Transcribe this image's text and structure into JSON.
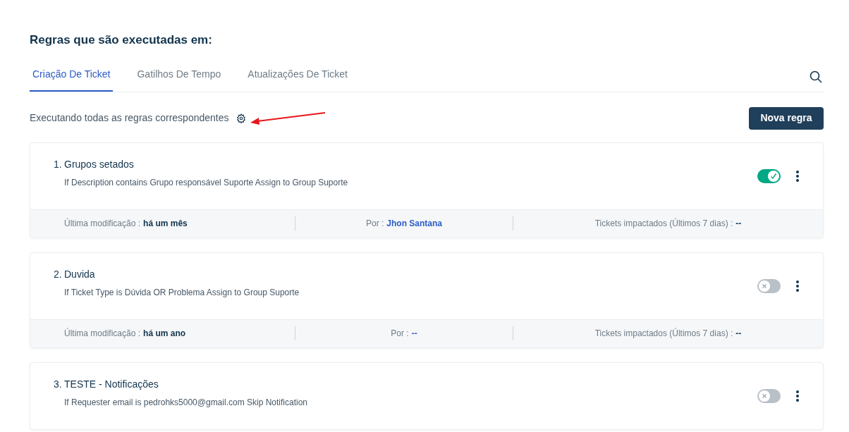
{
  "title": "Regras que são executadas em:",
  "tabs": [
    {
      "label": "Criação De Ticket",
      "selected": true
    },
    {
      "label": "Gatilhos De Tempo",
      "selected": false
    },
    {
      "label": "Atualizações De Ticket",
      "selected": false
    }
  ],
  "mode_text": "Executando todas as regras correspondentes",
  "new_button": "Nova regra",
  "rules": [
    {
      "number": "1.",
      "name": "Grupos setados",
      "description": "If Description contains Grupo responsável Suporte Assign to Group Suporte",
      "on": true,
      "footer": {
        "modified_label": "Última modificação :",
        "modified_value": "há um mês",
        "by_label": "Por :",
        "by_value": "Jhon Santana",
        "impact_label": "Tickets impactados (Últimos 7 dias) :",
        "impact_value": "--"
      }
    },
    {
      "number": "2.",
      "name": "Duvida",
      "description": "If Ticket Type is Dúvida OR Problema Assign to Group Suporte",
      "on": false,
      "footer": {
        "modified_label": "Última modificação :",
        "modified_value": "há um ano",
        "by_label": "Por :",
        "by_value": "--",
        "impact_label": "Tickets impactados (Últimos 7 dias) :",
        "impact_value": "--"
      }
    },
    {
      "number": "3.",
      "name": "TESTE - Notificações",
      "description": "If Requester email is pedrohks5000@gmail.com Skip Notification",
      "on": false
    }
  ]
}
